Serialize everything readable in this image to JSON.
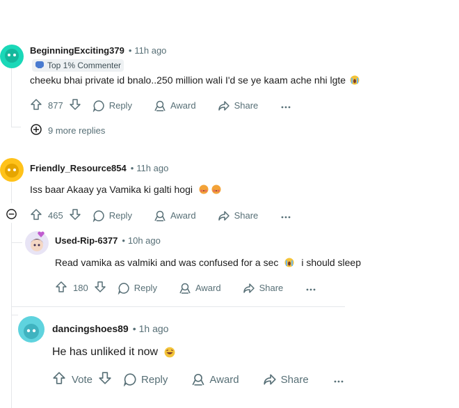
{
  "comments": [
    {
      "username": "BeginningExciting379",
      "time": "11h ago",
      "flair": "Top 1% Commenter",
      "text": "cheeku bhai private id bnalo..250 million wali I'd se ye kaam ache nhi lgte",
      "votes": "877",
      "reply": "Reply",
      "award": "Award",
      "share": "Share",
      "more_replies": "9 more replies"
    },
    {
      "username": "Friendly_Resource854",
      "time": "11h ago",
      "text": "Iss baar Akaay ya Vamika ki galti hogi",
      "votes": "465",
      "reply": "Reply",
      "award": "Award",
      "share": "Share"
    },
    {
      "username": "Used-Rip-6377",
      "time": "10h ago",
      "text": "Read vamika as valmiki and was confused for a sec",
      "text2": "i should sleep",
      "votes": "180",
      "reply": "Reply",
      "award": "Award",
      "share": "Share"
    },
    {
      "username": "dancingshoes89",
      "time": "1h ago",
      "text": "He has unliked it now",
      "votes": "Vote",
      "reply": "Reply",
      "award": "Award",
      "share": "Share"
    }
  ],
  "colors": {
    "avatar1": "#1ad8b8",
    "avatar2": "#ffc21a",
    "avatar4": "#5fd3de",
    "meta": "#576f76",
    "thread": "#e5e7ea"
  },
  "icons": [
    "upvote-icon",
    "downvote-icon",
    "comment-icon",
    "award-icon",
    "share-icon",
    "more-icon",
    "expand-icon",
    "collapse-icon",
    "crying-emoji",
    "blushing-emoji",
    "laughing-emoji",
    "flair-icon"
  ]
}
